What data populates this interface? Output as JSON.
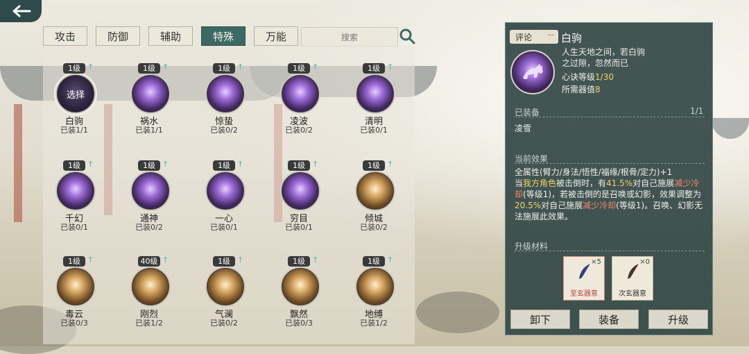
{
  "tabs": [
    "攻击",
    "防御",
    "辅助",
    "特殊",
    "万能"
  ],
  "active_tab": 3,
  "search_placeholder": "搜索",
  "skills": [
    {
      "level": "1级",
      "name": "白驹",
      "installed": "已装1/1",
      "color": "dark",
      "orb_text": "选择",
      "selected": true
    },
    {
      "level": "1级",
      "name": "祸水",
      "installed": "已装1/1",
      "color": "purple"
    },
    {
      "level": "1级",
      "name": "惊蛰",
      "installed": "已装0/2",
      "color": "purple"
    },
    {
      "level": "1级",
      "name": "凌波",
      "installed": "已装0/2",
      "color": "purple"
    },
    {
      "level": "1级",
      "name": "清明",
      "installed": "已装0/1",
      "color": "purple"
    },
    {
      "level": "1级",
      "name": "千幻",
      "installed": "已装0/1",
      "color": "purple"
    },
    {
      "level": "1级",
      "name": "通神",
      "installed": "已装0/2",
      "color": "purple"
    },
    {
      "level": "1级",
      "name": "一心",
      "installed": "已装0/1",
      "color": "purple"
    },
    {
      "level": "1级",
      "name": "穷目",
      "installed": "已装0/1",
      "color": "purple"
    },
    {
      "level": "1级",
      "name": "倾城",
      "installed": "已装0/2",
      "color": "gold"
    },
    {
      "level": "1级",
      "name": "毒云",
      "installed": "已装0/3",
      "color": "gold"
    },
    {
      "level": "40级",
      "name": "刚烈",
      "installed": "已装1/2",
      "color": "gold"
    },
    {
      "level": "1级",
      "name": "气澜",
      "installed": "已装0/2",
      "color": "gold"
    },
    {
      "level": "1级",
      "name": "飘然",
      "installed": "已装0/3",
      "color": "gold"
    },
    {
      "level": "1级",
      "name": "地缚",
      "installed": "已装1/2",
      "color": "gold"
    }
  ],
  "detail": {
    "comment_label": "评论",
    "comment_dots": "···",
    "title": "白驹",
    "desc": "人生天地之间，若白驹之过隙，忽然而已",
    "level_label": "心诀等级",
    "level_value": "1/30",
    "cost_label": "所需器值",
    "cost_value": "8",
    "equipped_label": "已装备",
    "equipped_count": "1/1",
    "equipped_name": "凌雪",
    "effect_label": "当前效果",
    "effect_line1": "全属性(臂力/身法/悟性/福缘/根骨/定力)+1",
    "effect_p1": "当",
    "effect_hl1": "我方角色",
    "effect_p2": "被击倒时，有",
    "effect_hl2": "41.5%",
    "effect_p3": "对自己施展",
    "effect_hl3": "减少冷却",
    "effect_p4": "(等级1)，若被击倒的是召唤或幻影，效果调整为",
    "effect_hl4": "20.5%",
    "effect_p5": "对自己施展",
    "effect_hl5": "减少冷却",
    "effect_p6": "(等级1)。召唤、幻影无法施展此效果。",
    "upgrade_label": "升级材料",
    "materials": [
      {
        "name": "至玄器意",
        "count": "×5"
      },
      {
        "name": "次玄器意",
        "count": "×0"
      }
    ]
  },
  "buttons": {
    "unequip": "卸下",
    "equip": "装备",
    "upgrade": "升级"
  },
  "colors": {
    "accent": "#3c6963",
    "panel": "#344846",
    "highlight": "#f0d36a",
    "warn": "#f18a6a"
  }
}
